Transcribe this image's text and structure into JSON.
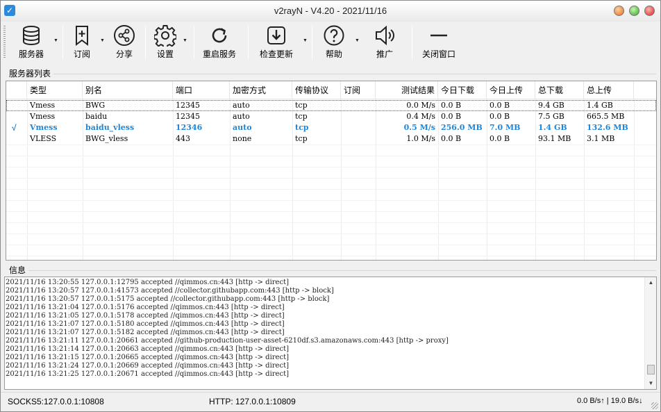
{
  "window": {
    "title": "v2rayN - V4.20 - 2021/11/16",
    "icon": "v2rayn-logo-icon"
  },
  "toolbar": {
    "servers": "服务器",
    "subscribe": "订阅",
    "share": "分享",
    "settings": "设置",
    "restart": "重启服务",
    "check_update": "检查更新",
    "help": "帮助",
    "promotion": "推广",
    "close_window": "关闭窗口",
    "icons": [
      "database-icon",
      "bookmark-add-icon",
      "share-icon",
      "gear-icon",
      "refresh-icon",
      "download-icon",
      "help-icon",
      "speaker-icon",
      "minus-icon"
    ]
  },
  "server_list": {
    "label": "服务器列表",
    "columns": [
      "类型",
      "别名",
      "端口",
      "加密方式",
      "传输协议",
      "订阅",
      "测试结果",
      "今日下载",
      "今日上传",
      "总下载",
      "总上传"
    ],
    "rows": [
      {
        "active": "",
        "type": "Vmess",
        "alias": "BWG",
        "port": "12345",
        "security": "auto",
        "network": "tcp",
        "sub": "",
        "test": "0.0 M/s",
        "today_down": "0.0 B",
        "today_up": "0.0 B",
        "total_down": "9.4 GB",
        "total_up": "1.4 GB"
      },
      {
        "active": "",
        "type": "Vmess",
        "alias": "baidu",
        "port": "12345",
        "security": "auto",
        "network": "tcp",
        "sub": "",
        "test": "0.4 M/s",
        "today_down": "0.0 B",
        "today_up": "0.0 B",
        "total_down": "7.5 GB",
        "total_up": "665.5 MB"
      },
      {
        "active": "√",
        "type": "Vmess",
        "alias": "baidu_vless",
        "port": "12346",
        "security": "auto",
        "network": "tcp",
        "sub": "",
        "test": "0.5 M/s",
        "today_down": "256.0 MB",
        "today_up": "7.0 MB",
        "total_down": "1.4 GB",
        "total_up": "132.6 MB"
      },
      {
        "active": "",
        "type": "VLESS",
        "alias": "BWG_vless",
        "port": "443",
        "security": "none",
        "network": "tcp",
        "sub": "",
        "test": "1.0 M/s",
        "today_down": "0.0 B",
        "today_up": "0.0 B",
        "total_down": "93.1 MB",
        "total_up": "3.1 MB"
      }
    ]
  },
  "info": {
    "label": "信息",
    "lines": [
      "2021/11/16 13:20:55 127.0.0.1:12795 accepted //qimmos.cn:443 [http -> direct]",
      "2021/11/16 13:20:57 127.0.0.1:41573 accepted //collector.githubapp.com:443 [http -> block]",
      "2021/11/16 13:20:57 127.0.0.1:5175 accepted //collector.githubapp.com:443 [http -> block]",
      "2021/11/16 13:21:04 127.0.0.1:5176 accepted //qimmos.cn:443 [http -> direct]",
      "2021/11/16 13:21:05 127.0.0.1:5178 accepted //qimmos.cn:443 [http -> direct]",
      "2021/11/16 13:21:07 127.0.0.1:5180 accepted //qimmos.cn:443 [http -> direct]",
      "2021/11/16 13:21:07 127.0.0.1:5182 accepted //qimmos.cn:443 [http -> direct]",
      "2021/11/16 13:21:11 127.0.0.1:20661 accepted //github-production-user-asset-6210df.s3.amazonaws.com:443 [http -> proxy]",
      "2021/11/16 13:21:14 127.0.0.1:20663 accepted //qimmos.cn:443 [http -> direct]",
      "2021/11/16 13:21:15 127.0.0.1:20665 accepted //qimmos.cn:443 [http -> direct]",
      "2021/11/16 13:21:24 127.0.0.1:20669 accepted //qimmos.cn:443 [http -> direct]",
      "2021/11/16 13:21:25 127.0.0.1:20671 accepted //qimmos.cn:443 [http -> direct]"
    ]
  },
  "status": {
    "socks_label": "SOCKS5:",
    "socks_value": "127.0.0.1:10808",
    "http_label": "HTTP:",
    "http_value": "127.0.0.1:10809",
    "speed": "0.0 B/s↑ | 19.0 B/s↓"
  },
  "colors": {
    "accent": "#1f86d8"
  }
}
